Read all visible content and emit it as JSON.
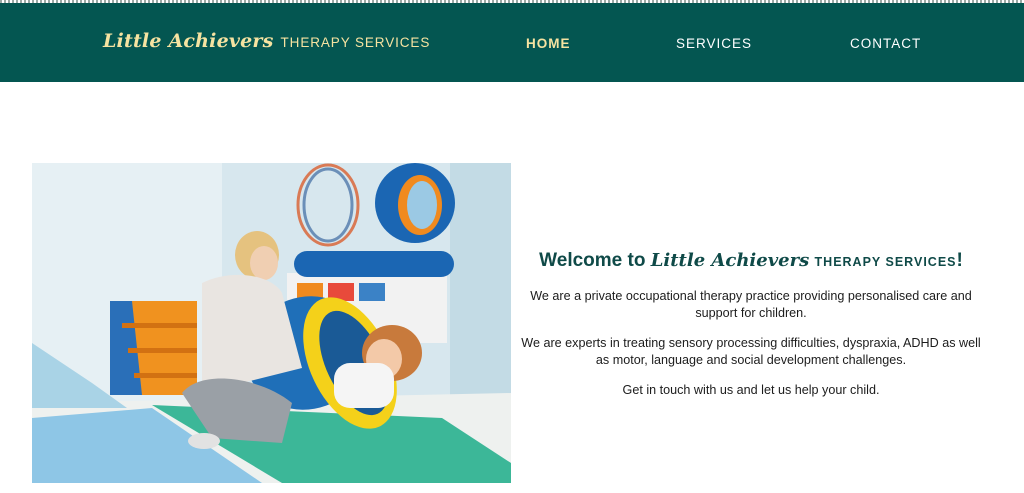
{
  "brand": {
    "name": "Little Achievers",
    "tagline": "THERAPY SERVICES"
  },
  "nav": {
    "home": "HOME",
    "services": "SERVICES",
    "contact": "CONTACT"
  },
  "colors": {
    "navbar_bg": "#045651",
    "brand_text": "#f6e3a1",
    "active_nav": "#f6e3a1",
    "title_text": "#0f4a48"
  },
  "welcome": {
    "prefix": "Welcome to ",
    "brand": "Little Achievers",
    "tagline": "THERAPY SERVICES",
    "suffix": "!",
    "p1": "We are a private occupational therapy practice providing personalised care and support for children.",
    "p2": "We are experts in treating sensory processing difficulties, dyspraxia, ADHD as well as motor, language and social development challenges.",
    "p3": "Get in touch with us and let us help your child."
  }
}
